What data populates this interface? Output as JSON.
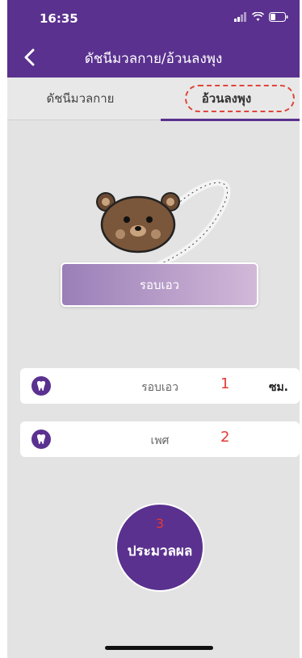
{
  "status_bar": {
    "time": "16:35"
  },
  "nav": {
    "title": "ดัชนีมวลกาย/อ้วนลงพุง"
  },
  "tabs": [
    {
      "label": "ดัชนีมวลกาย"
    },
    {
      "label": "อ้วนลงพุง"
    }
  ],
  "measure_button": {
    "label": "รอบเอว"
  },
  "fields": {
    "waist": {
      "label": "รอบเอว",
      "value": "1",
      "unit": "ซม."
    },
    "gender": {
      "label": "เพศ",
      "value": "2"
    }
  },
  "process_button": {
    "step": "3",
    "label": "ประมวลผล"
  },
  "colors": {
    "primary": "#5a318f",
    "annotation": "#e53935"
  }
}
